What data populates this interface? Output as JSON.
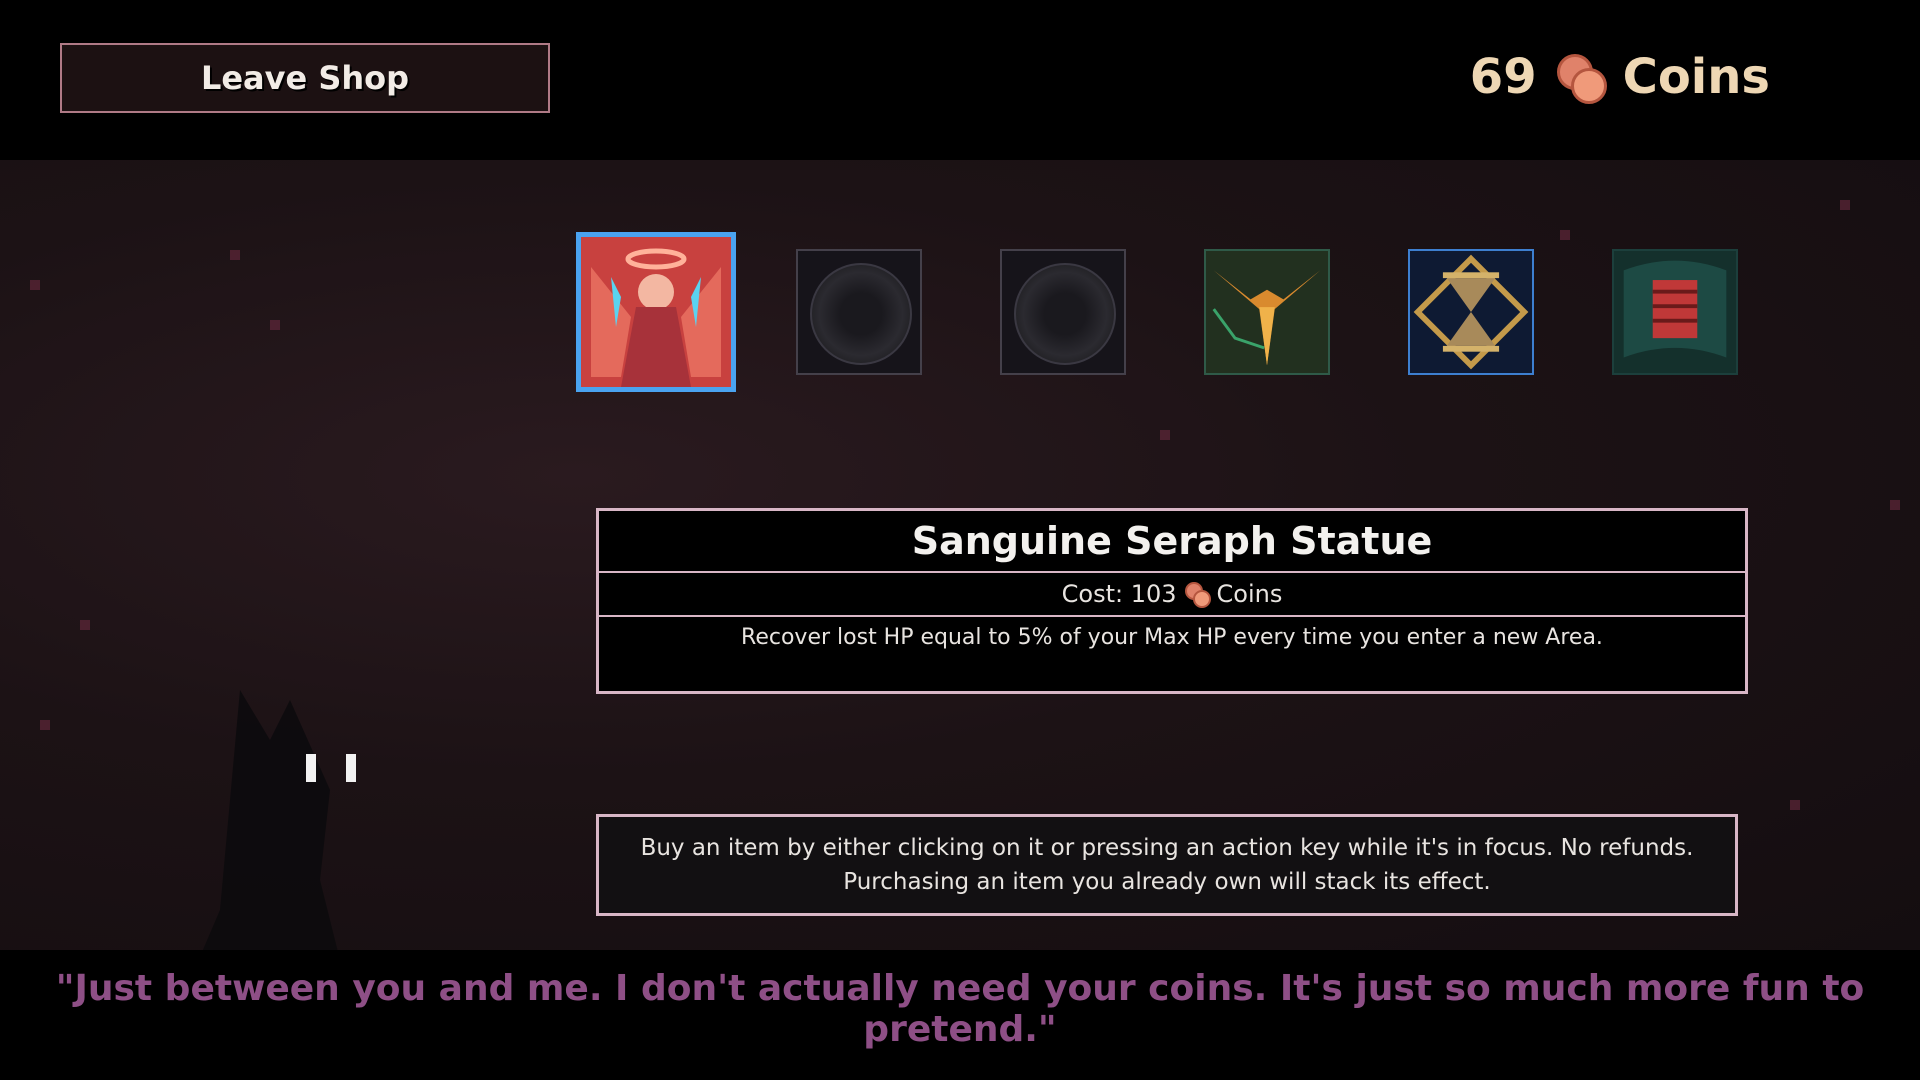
{
  "header": {
    "leave_label": "Leave Shop",
    "coin_count": "69",
    "coin_label": "Coins",
    "coin_icon": "coin-stack-icon"
  },
  "shop": {
    "items": [
      {
        "name": "Sanguine Seraph Statue",
        "icon": "seraph-statue-icon",
        "selected": true
      },
      {
        "name": "",
        "icon": "empty-slot-icon",
        "selected": false
      },
      {
        "name": "",
        "icon": "empty-slot-icon",
        "selected": false
      },
      {
        "name": "",
        "icon": "winged-sword-icon",
        "selected": false
      },
      {
        "name": "",
        "icon": "hourglass-icon",
        "selected": false
      },
      {
        "name": "",
        "icon": "blood-banner-icon",
        "selected": false
      }
    ]
  },
  "detail": {
    "title": "Sanguine Seraph Statue",
    "cost_prefix": "Cost: 103",
    "cost_unit": "Coins",
    "description": "Recover lost HP equal to 5% of your Max HP every time you enter a new Area."
  },
  "info": {
    "line1": "Buy an item by either clicking on it or pressing an action key while it's in focus. No refunds.",
    "line2": "Purchasing an item you already own will stack its effect."
  },
  "dialogue": {
    "quote": "\"Just between you and me. I don't actually need your coins. It's just so much more fun to pretend.\""
  },
  "colors": {
    "selected_border": "#4aa3f0",
    "panel_border": "#d8b6c6",
    "quote": "#8e4f86",
    "coins": "#eed7b4"
  }
}
